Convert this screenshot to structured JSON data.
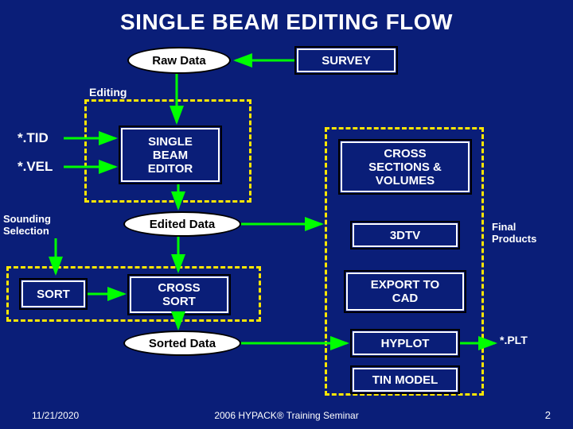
{
  "title": "SINGLE BEAM EDITING FLOW",
  "ovals": {
    "raw_data": "Raw Data",
    "edited_data": "Edited Data",
    "sorted_data": "Sorted Data"
  },
  "boxes": {
    "survey": "SURVEY",
    "single_beam_editor": "SINGLE\nBEAM\nEDITOR",
    "cross_sort": "CROSS\nSORT",
    "cross_sections": "CROSS\nSECTIONS &\nVOLUMES",
    "tdv": "3DTV",
    "export_cad": "EXPORT TO\nCAD",
    "hyplot": "HYPLOT",
    "tin_model": "TIN MODEL",
    "sort": "SORT"
  },
  "labels": {
    "editing": "Editing",
    "tid": "*.TID",
    "vel": "*.VEL",
    "sounding_selection": "Sounding\nSelection",
    "final_products": "Final\nProducts",
    "plt": "*.PLT"
  },
  "footer": {
    "date": "11/21/2020",
    "center": "2006 HYPACK® Training Seminar",
    "page": "2"
  }
}
